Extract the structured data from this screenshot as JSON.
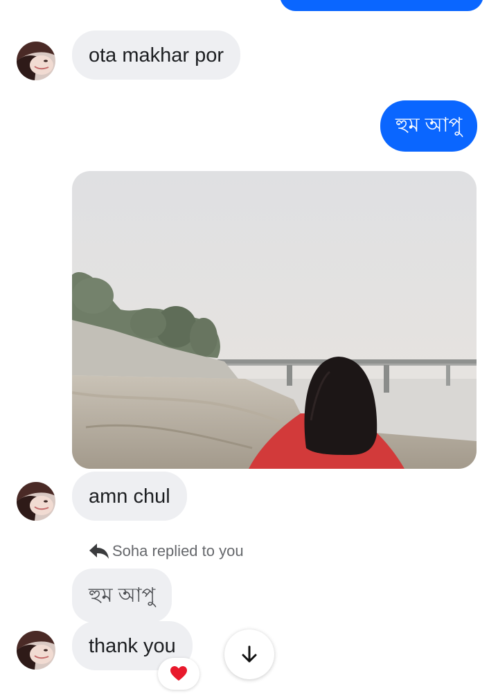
{
  "messages": [
    {
      "id": "m1",
      "direction": "incoming",
      "text": "ota makhar por"
    },
    {
      "id": "m2",
      "direction": "outgoing",
      "text": "হুম আপু"
    },
    {
      "id": "m3",
      "direction": "incoming",
      "type": "photo"
    },
    {
      "id": "m4",
      "direction": "incoming",
      "text": "amn chul"
    },
    {
      "id": "m5",
      "direction": "incoming",
      "text": "হুম আপু",
      "quoted": true
    },
    {
      "id": "m6",
      "direction": "incoming",
      "text": "thank you",
      "reaction": "heart"
    }
  ],
  "reply_note": {
    "text": "Soha replied to you",
    "icon": "reply-arrow-icon"
  },
  "reaction": {
    "icon": "heart-icon",
    "color": "#e8192c"
  },
  "scroll_button": {
    "icon": "arrow-down-icon"
  },
  "colors": {
    "incoming_bubble": "#eeeff2",
    "outgoing_bubble": "#0a66ff",
    "meta_text": "#65676b"
  }
}
